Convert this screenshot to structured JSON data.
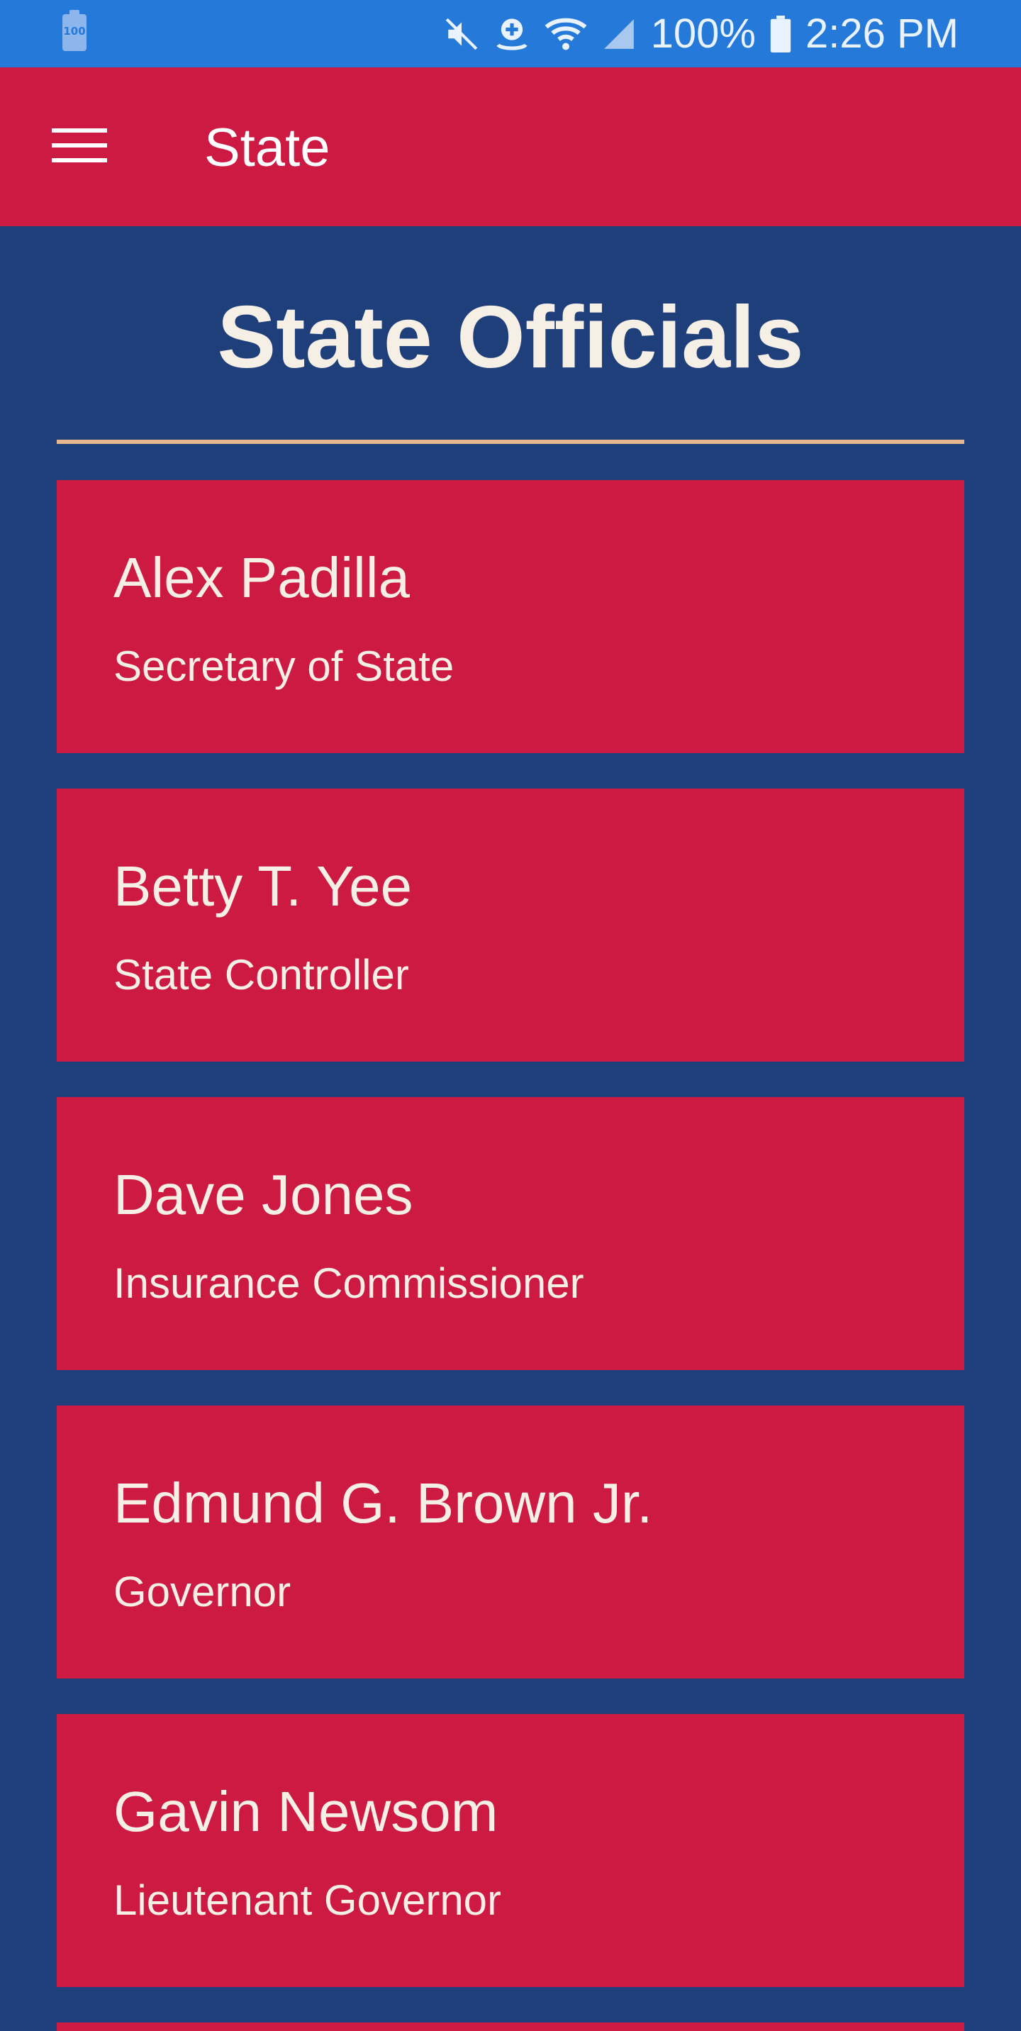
{
  "status_bar": {
    "battery_small_label": "100",
    "battery_percent": "100%",
    "time": "2:26 PM",
    "icons": [
      "battery-icon",
      "mute-icon",
      "location-icon",
      "wifi-icon",
      "signal-icon",
      "battery-icon"
    ]
  },
  "app_bar": {
    "title": "State",
    "menu_icon": "menu-icon"
  },
  "page": {
    "heading": "State Officials"
  },
  "officials": [
    {
      "name": "Alex Padilla",
      "title": "Secretary of State"
    },
    {
      "name": "Betty T. Yee",
      "title": "State Controller"
    },
    {
      "name": "Dave Jones",
      "title": "Insurance Commissioner"
    },
    {
      "name": "Edmund G. Brown Jr.",
      "title": "Governor"
    },
    {
      "name": "Gavin Newsom",
      "title": "Lieutenant Governor"
    },
    {
      "name": "",
      "title": ""
    }
  ],
  "colors": {
    "status_bar": "#2579d9",
    "app_bar": "#cd1a42",
    "background": "#1f3f7b",
    "card": "#cd1a42",
    "divider": "#e6b78e",
    "text": "#f6efe6"
  }
}
